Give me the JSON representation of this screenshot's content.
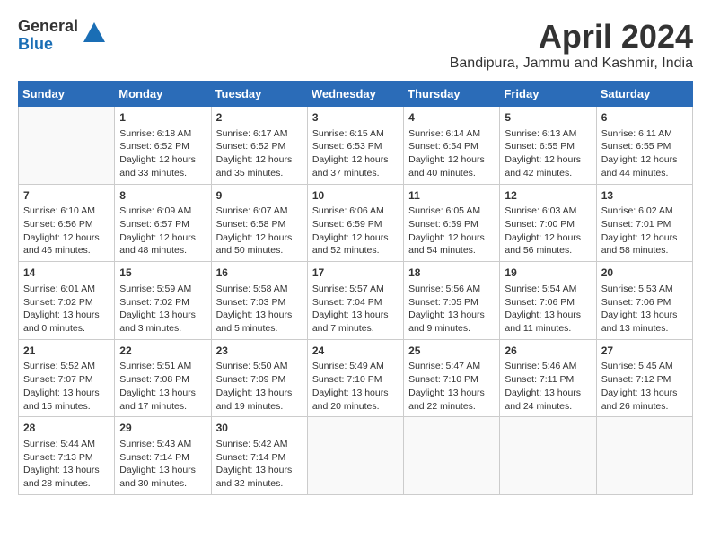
{
  "header": {
    "logo_general": "General",
    "logo_blue": "Blue",
    "month_title": "April 2024",
    "location": "Bandipura, Jammu and Kashmir, India"
  },
  "weekdays": [
    "Sunday",
    "Monday",
    "Tuesday",
    "Wednesday",
    "Thursday",
    "Friday",
    "Saturday"
  ],
  "weeks": [
    [
      {
        "day": "",
        "data": ""
      },
      {
        "day": "1",
        "data": "Sunrise: 6:18 AM\nSunset: 6:52 PM\nDaylight: 12 hours\nand 33 minutes."
      },
      {
        "day": "2",
        "data": "Sunrise: 6:17 AM\nSunset: 6:52 PM\nDaylight: 12 hours\nand 35 minutes."
      },
      {
        "day": "3",
        "data": "Sunrise: 6:15 AM\nSunset: 6:53 PM\nDaylight: 12 hours\nand 37 minutes."
      },
      {
        "day": "4",
        "data": "Sunrise: 6:14 AM\nSunset: 6:54 PM\nDaylight: 12 hours\nand 40 minutes."
      },
      {
        "day": "5",
        "data": "Sunrise: 6:13 AM\nSunset: 6:55 PM\nDaylight: 12 hours\nand 42 minutes."
      },
      {
        "day": "6",
        "data": "Sunrise: 6:11 AM\nSunset: 6:55 PM\nDaylight: 12 hours\nand 44 minutes."
      }
    ],
    [
      {
        "day": "7",
        "data": "Sunrise: 6:10 AM\nSunset: 6:56 PM\nDaylight: 12 hours\nand 46 minutes."
      },
      {
        "day": "8",
        "data": "Sunrise: 6:09 AM\nSunset: 6:57 PM\nDaylight: 12 hours\nand 48 minutes."
      },
      {
        "day": "9",
        "data": "Sunrise: 6:07 AM\nSunset: 6:58 PM\nDaylight: 12 hours\nand 50 minutes."
      },
      {
        "day": "10",
        "data": "Sunrise: 6:06 AM\nSunset: 6:59 PM\nDaylight: 12 hours\nand 52 minutes."
      },
      {
        "day": "11",
        "data": "Sunrise: 6:05 AM\nSunset: 6:59 PM\nDaylight: 12 hours\nand 54 minutes."
      },
      {
        "day": "12",
        "data": "Sunrise: 6:03 AM\nSunset: 7:00 PM\nDaylight: 12 hours\nand 56 minutes."
      },
      {
        "day": "13",
        "data": "Sunrise: 6:02 AM\nSunset: 7:01 PM\nDaylight: 12 hours\nand 58 minutes."
      }
    ],
    [
      {
        "day": "14",
        "data": "Sunrise: 6:01 AM\nSunset: 7:02 PM\nDaylight: 13 hours\nand 0 minutes."
      },
      {
        "day": "15",
        "data": "Sunrise: 5:59 AM\nSunset: 7:02 PM\nDaylight: 13 hours\nand 3 minutes."
      },
      {
        "day": "16",
        "data": "Sunrise: 5:58 AM\nSunset: 7:03 PM\nDaylight: 13 hours\nand 5 minutes."
      },
      {
        "day": "17",
        "data": "Sunrise: 5:57 AM\nSunset: 7:04 PM\nDaylight: 13 hours\nand 7 minutes."
      },
      {
        "day": "18",
        "data": "Sunrise: 5:56 AM\nSunset: 7:05 PM\nDaylight: 13 hours\nand 9 minutes."
      },
      {
        "day": "19",
        "data": "Sunrise: 5:54 AM\nSunset: 7:06 PM\nDaylight: 13 hours\nand 11 minutes."
      },
      {
        "day": "20",
        "data": "Sunrise: 5:53 AM\nSunset: 7:06 PM\nDaylight: 13 hours\nand 13 minutes."
      }
    ],
    [
      {
        "day": "21",
        "data": "Sunrise: 5:52 AM\nSunset: 7:07 PM\nDaylight: 13 hours\nand 15 minutes."
      },
      {
        "day": "22",
        "data": "Sunrise: 5:51 AM\nSunset: 7:08 PM\nDaylight: 13 hours\nand 17 minutes."
      },
      {
        "day": "23",
        "data": "Sunrise: 5:50 AM\nSunset: 7:09 PM\nDaylight: 13 hours\nand 19 minutes."
      },
      {
        "day": "24",
        "data": "Sunrise: 5:49 AM\nSunset: 7:10 PM\nDaylight: 13 hours\nand 20 minutes."
      },
      {
        "day": "25",
        "data": "Sunrise: 5:47 AM\nSunset: 7:10 PM\nDaylight: 13 hours\nand 22 minutes."
      },
      {
        "day": "26",
        "data": "Sunrise: 5:46 AM\nSunset: 7:11 PM\nDaylight: 13 hours\nand 24 minutes."
      },
      {
        "day": "27",
        "data": "Sunrise: 5:45 AM\nSunset: 7:12 PM\nDaylight: 13 hours\nand 26 minutes."
      }
    ],
    [
      {
        "day": "28",
        "data": "Sunrise: 5:44 AM\nSunset: 7:13 PM\nDaylight: 13 hours\nand 28 minutes."
      },
      {
        "day": "29",
        "data": "Sunrise: 5:43 AM\nSunset: 7:14 PM\nDaylight: 13 hours\nand 30 minutes."
      },
      {
        "day": "30",
        "data": "Sunrise: 5:42 AM\nSunset: 7:14 PM\nDaylight: 13 hours\nand 32 minutes."
      },
      {
        "day": "",
        "data": ""
      },
      {
        "day": "",
        "data": ""
      },
      {
        "day": "",
        "data": ""
      },
      {
        "day": "",
        "data": ""
      }
    ]
  ]
}
